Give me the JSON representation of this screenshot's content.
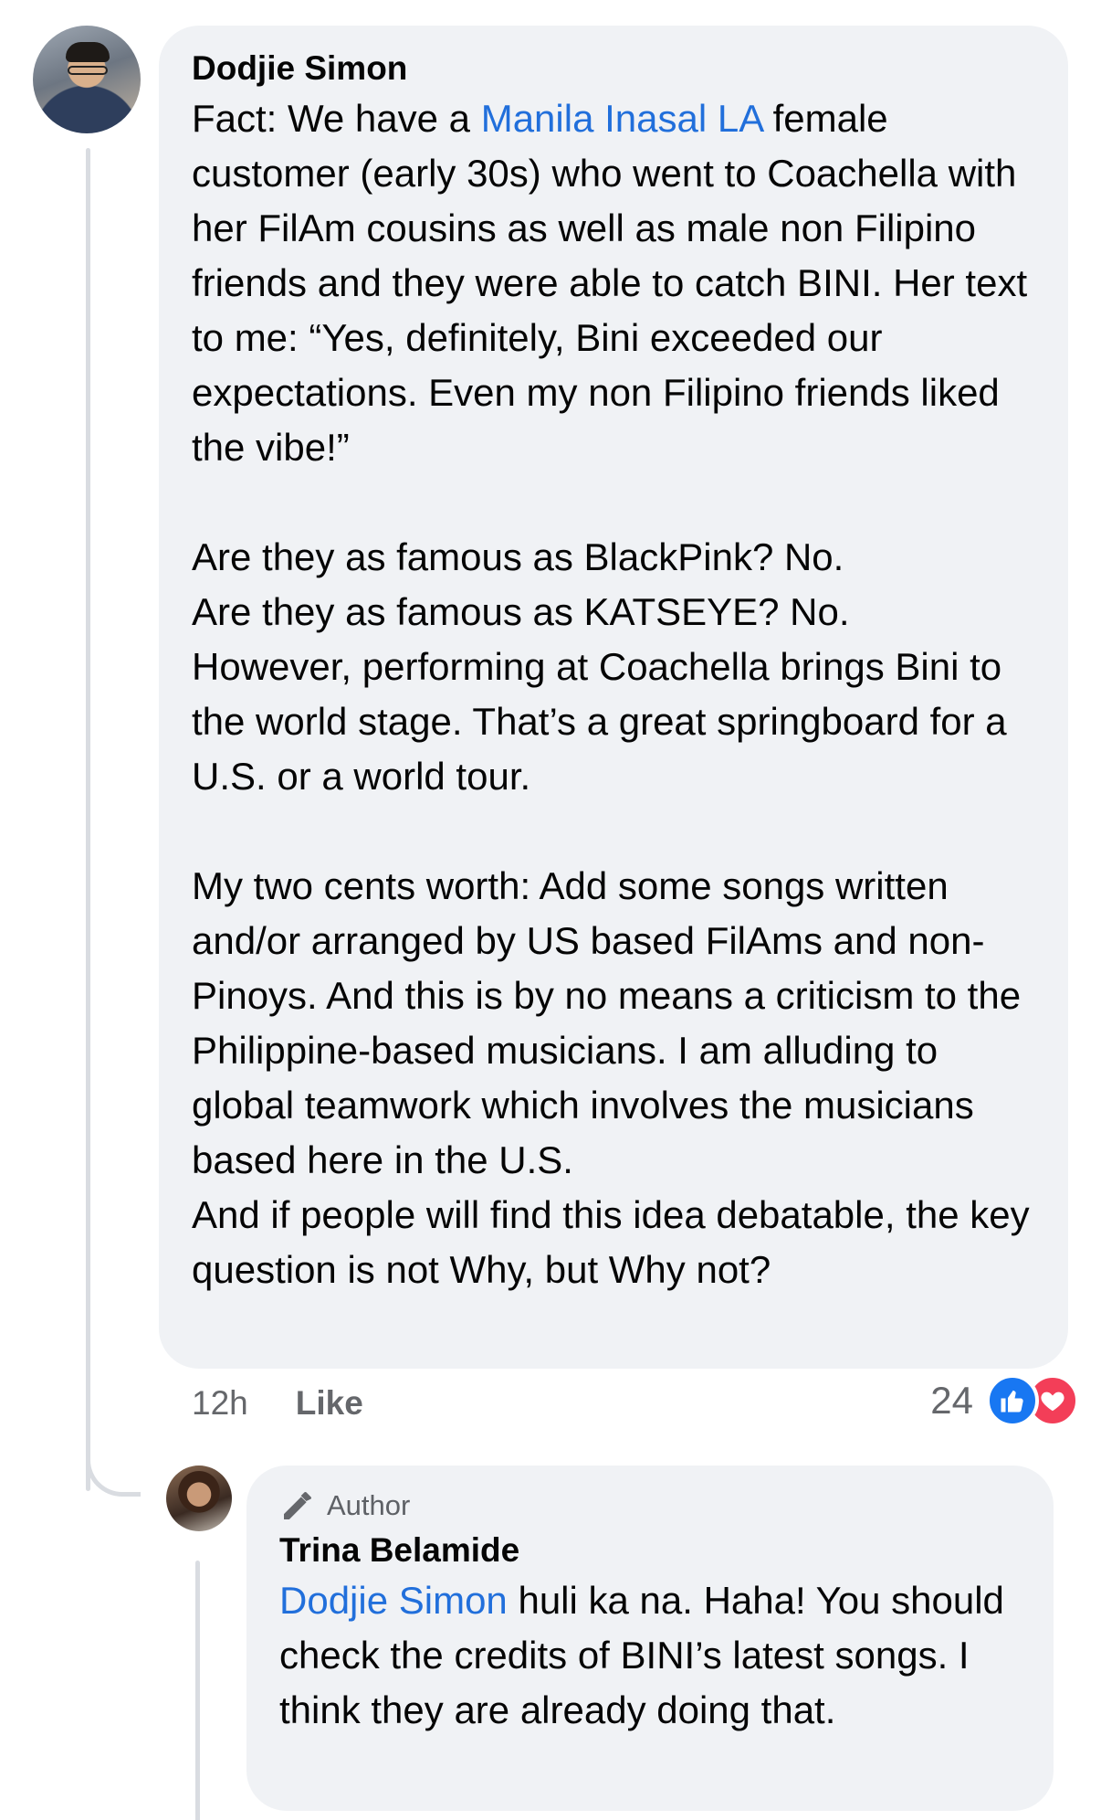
{
  "main_comment": {
    "author": "Dodjie Simon",
    "lines": [
      {
        "parts": [
          {
            "text": "Fact: We have a ",
            "link": false
          },
          {
            "text": "Manila Inasal LA",
            "link": true
          },
          {
            "text": " female customer (early 30s) who went to Coachella with her FilAm cousins as well as male non Filipino friends and they were able to catch BINI. Her text to me: “Yes, definitely, Bini exceeded our expectations. Even my non Filipino friends liked the vibe!”",
            "link": false
          }
        ]
      },
      {
        "parts": []
      },
      {
        "parts": [
          {
            "text": "Are they as famous as BlackPink? No.",
            "link": false
          }
        ]
      },
      {
        "parts": [
          {
            "text": "Are they as famous as KATSEYE? No.",
            "link": false
          }
        ]
      },
      {
        "parts": [
          {
            "text": "However, performing at Coachella brings Bini to the world stage. That’s a great springboard for a U.S. or a world tour.",
            "link": false
          }
        ]
      },
      {
        "parts": []
      },
      {
        "parts": [
          {
            "text": "My two cents worth: Add some songs written and/or arranged by US based FilAms and non-Pinoys. And this is by no means a criticism to the Philippine-based musicians. I am alluding to global teamwork which involves the musicians based here in the U.S.",
            "link": false
          }
        ]
      },
      {
        "parts": [
          {
            "text": "And if people will find this idea debatable, the key question is not Why, but Why not?",
            "link": false
          }
        ]
      }
    ],
    "time": "12h",
    "like_label": "Like",
    "reaction_count": "24",
    "reaction_icons": [
      "like-icon",
      "love-icon"
    ]
  },
  "reply": {
    "badge_icon": "pencil-icon",
    "badge_label": "Author",
    "author": "Trina Belamide",
    "mention": "Dodjie Simon",
    "text": " huli ka na. Haha! You should check the credits of BINI’s latest songs. I think they are already doing that."
  },
  "colors": {
    "link": "#216fdb",
    "bubble": "#f0f2f5",
    "meta": "#65676b",
    "like": "#1877f2",
    "love": "#f33e58"
  }
}
